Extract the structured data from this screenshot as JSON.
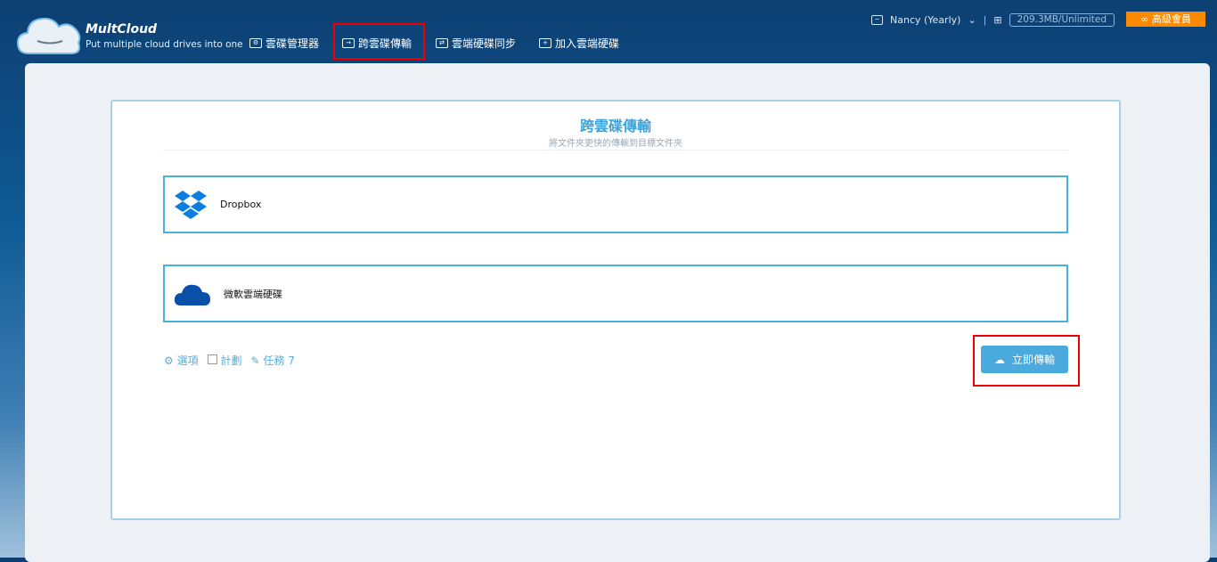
{
  "header": {
    "brand": "MultCloud",
    "tagline": "Put multiple cloud drives into one",
    "nav": [
      {
        "label": "雲碟管理器",
        "icon": "folder-gear-icon"
      },
      {
        "label": "跨雲碟傳輸",
        "icon": "folder-arrow-icon"
      },
      {
        "label": "雲端硬碟同步",
        "icon": "folder-sync-icon"
      },
      {
        "label": "加入雲端硬碟",
        "icon": "folder-plus-icon"
      }
    ],
    "user": "Nancy (Yearly)",
    "usage": "209.3MB/Unlimited",
    "premium": "高級會員"
  },
  "main": {
    "title": "跨雲碟傳輸",
    "subtitle": "將文件夾更快的傳輸到目標文件夾",
    "source": {
      "name": "Dropbox",
      "color": "#0d7de0"
    },
    "target": {
      "name": "微軟雲端硬碟",
      "color": "#0a4fa8"
    },
    "options": "選項",
    "schedule": "計劃",
    "tasks": "任務",
    "task_count": "7",
    "transfer_button": "立即傳輸"
  },
  "colors": {
    "accent": "#4aa9dd",
    "premium": "#ff8a00",
    "highlight": "#e00000"
  }
}
